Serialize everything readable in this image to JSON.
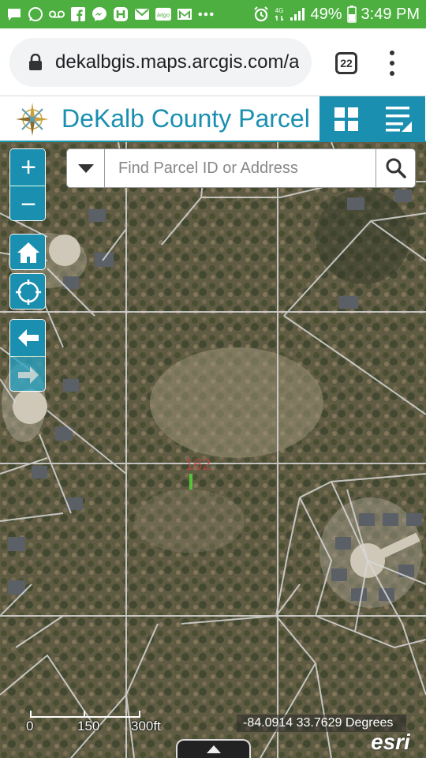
{
  "status_bar": {
    "icons": [
      "message-icon",
      "whatsapp-icon",
      "voicemail-icon",
      "facebook-icon",
      "messenger-icon",
      "app-icon",
      "mail-icon",
      "letgo-icon",
      "gmail-icon",
      "more-dots-icon",
      "alarm-icon",
      "lte-icon",
      "signal-icon"
    ],
    "letgo_text": "letgo",
    "network_text": "4G",
    "battery": "49%",
    "time": "3:49 PM"
  },
  "browser": {
    "url": "dekalbgis.maps.arcgis.com/a",
    "tab_count": "22"
  },
  "app": {
    "title": "DeKalb County Parcel Viewer",
    "header_color": "#1a8fb0"
  },
  "map": {
    "zoom_in": "+",
    "zoom_out": "−",
    "search_placeholder": "Find Parcel ID or Address",
    "search_value": "",
    "parcel_label": "162",
    "scale": {
      "ticks": [
        "0",
        "150",
        "300ft"
      ]
    },
    "coordinates": "-84.0914 33.7629 Degrees",
    "attribution_logo": "esri"
  }
}
